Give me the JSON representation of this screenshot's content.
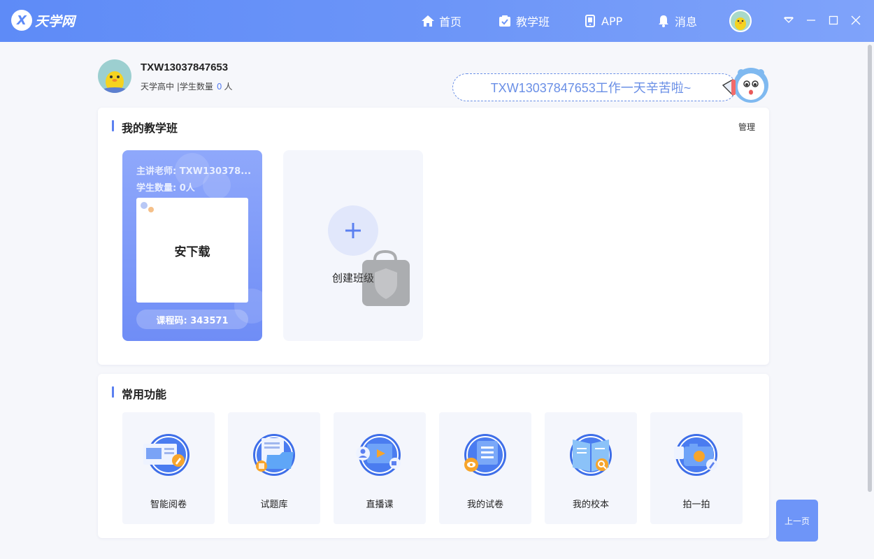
{
  "app": {
    "logo_text": "天学网"
  },
  "nav": {
    "home": "首页",
    "class": "教学班",
    "app": "APP",
    "messages": "消息"
  },
  "profile": {
    "name": "TXW13037847653",
    "school": "天学高中",
    "separator": "|",
    "students_label": "学生数量",
    "students_count": "0",
    "students_unit": "人"
  },
  "greeting": "TXW13037847653工作一天辛苦啦~",
  "class_panel": {
    "title": "我的教学班",
    "manage": "管理",
    "card": {
      "teacher": "主讲老师: TXW130378...",
      "students": "学生数量: 0人",
      "thumb_text": "安下载",
      "code": "课程码: 343571"
    },
    "create_label": "创建班级"
  },
  "func_panel": {
    "title": "常用功能",
    "items": [
      {
        "label": "智能阅卷",
        "icon": "grading-icon"
      },
      {
        "label": "试题库",
        "icon": "question-bank-icon"
      },
      {
        "label": "直播课",
        "icon": "live-class-icon"
      },
      {
        "label": "我的试卷",
        "icon": "my-papers-icon"
      },
      {
        "label": "我的校本",
        "icon": "school-book-icon"
      },
      {
        "label": "拍一拍",
        "icon": "camera-icon"
      }
    ]
  },
  "prev_page": "上一页",
  "colors": {
    "accent": "#5b80f0",
    "topbar": "#6c95f8",
    "tile_bg": "#f4f6fc"
  }
}
